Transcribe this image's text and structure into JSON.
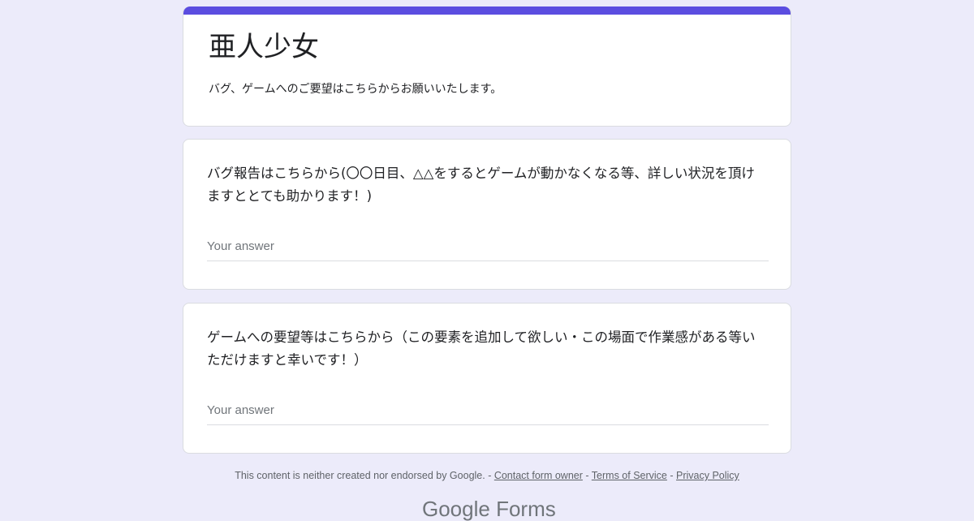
{
  "form": {
    "title": "亜人少女",
    "description": "バグ、ゲームへのご要望はこちらからお願いいたします。",
    "accent_color": "#5b4de0",
    "background_color": "#ecebfa"
  },
  "questions": [
    {
      "text": "バグ報告はこちらから(〇〇日目、△△をするとゲームが動かなくなる等、詳しい状況を頂けますととても助かります！)",
      "placeholder": "Your answer"
    },
    {
      "text": "ゲームへの要望等はこちらから（この要素を追加して欲しい・この場面で作業感がある等いただけますと幸いです！）",
      "placeholder": "Your answer"
    }
  ],
  "footer": {
    "disclaimer": "This content is neither created nor endorsed by Google.",
    "sep1": " - ",
    "contact_link": "Contact form owner",
    "sep2": " - ",
    "terms_link": "Terms of Service",
    "sep3": " - ",
    "privacy_link": "Privacy Policy"
  },
  "brand": {
    "text": "Google Forms"
  }
}
